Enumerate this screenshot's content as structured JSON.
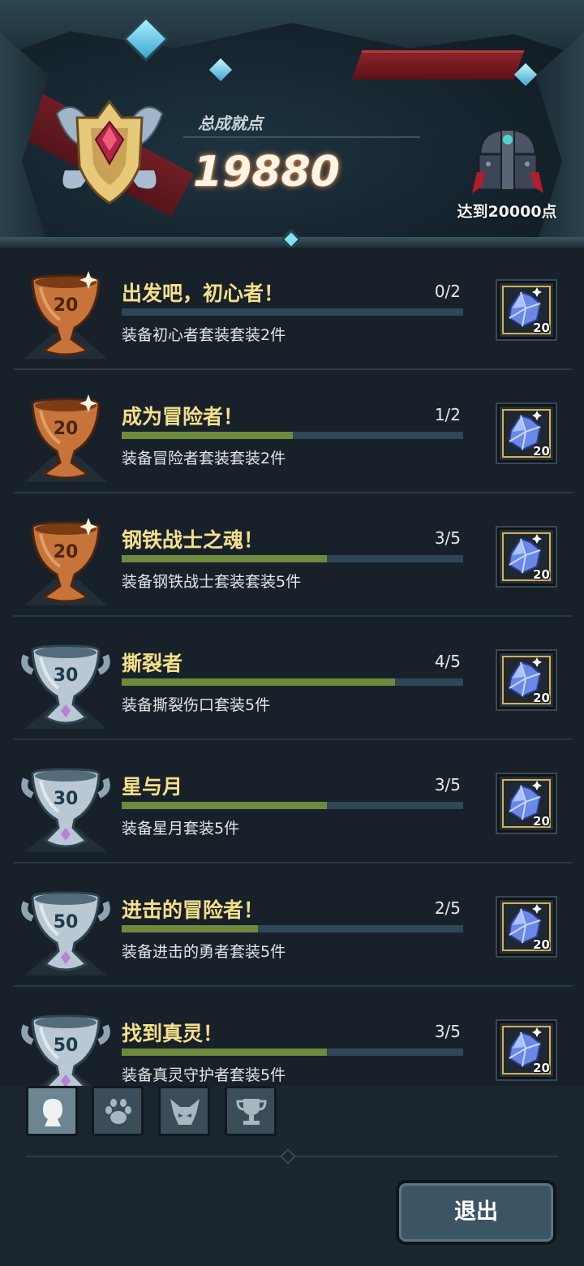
{
  "header": {
    "total_label": "总成就点",
    "total_points": "19880",
    "chest_label": "达到20000点"
  },
  "achievements": [
    {
      "cup": "bronze",
      "cup_number": "20",
      "title": "出发吧，初心者！",
      "count": "0/2",
      "progress": 0.0,
      "description": "装备初心者套装套装2件",
      "reward_amount": "20"
    },
    {
      "cup": "bronze",
      "cup_number": "20",
      "title": "成为冒险者！",
      "count": "1/2",
      "progress": 0.5,
      "description": "装备冒险者套装套装2件",
      "reward_amount": "20"
    },
    {
      "cup": "bronze",
      "cup_number": "20",
      "title": "钢铁战士之魂！",
      "count": "3/5",
      "progress": 0.6,
      "description": "装备钢铁战士套装套装5件",
      "reward_amount": "20"
    },
    {
      "cup": "silver",
      "cup_number": "30",
      "title": "撕裂者",
      "count": "4/5",
      "progress": 0.8,
      "description": "装备撕裂伤口套装5件",
      "reward_amount": "20"
    },
    {
      "cup": "silver",
      "cup_number": "30",
      "title": "星与月",
      "count": "3/5",
      "progress": 0.6,
      "description": "装备星月套装5件",
      "reward_amount": "20"
    },
    {
      "cup": "silver",
      "cup_number": "50",
      "title": "进击的冒险者！",
      "count": "2/5",
      "progress": 0.4,
      "description": "装备进击的勇者套装5件",
      "reward_amount": "20"
    },
    {
      "cup": "silver",
      "cup_number": "50",
      "title": "找到真灵！",
      "count": "3/5",
      "progress": 0.6,
      "description": "装备真灵守护者套装5件",
      "reward_amount": "20"
    }
  ],
  "tabs": [
    {
      "name": "character",
      "icon": "person-icon",
      "active": true
    },
    {
      "name": "pet",
      "icon": "paw-icon",
      "active": false
    },
    {
      "name": "monster",
      "icon": "monster-icon",
      "active": false
    },
    {
      "name": "trophy",
      "icon": "trophy-icon",
      "active": false
    }
  ],
  "exit_label": "退出",
  "colors": {
    "title": "#f5e08a",
    "progress_fill": "#6e8a3c",
    "progress_track": "#2f4757",
    "points_glow": "#e08a4a"
  }
}
